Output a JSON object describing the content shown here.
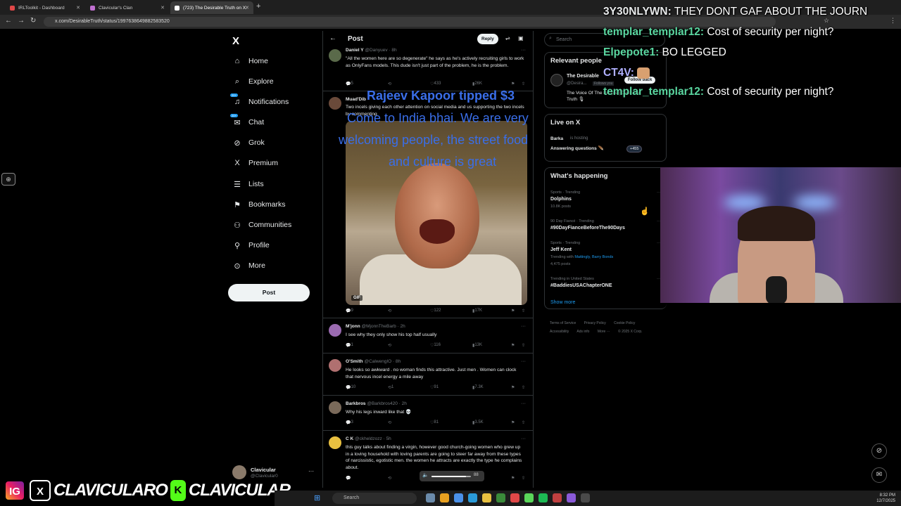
{
  "browser": {
    "tabs": [
      {
        "label": "IRLToolkit - Dashboard",
        "color": "#e04848"
      },
      {
        "label": "Clavicular's Clan",
        "color": "#c070d0"
      },
      {
        "label": "(723) The Desirable Truth on X:",
        "color": "#ffffff"
      }
    ],
    "new_tab": "+",
    "url": "x.com/DesirableTruth/status/1997638649882583520"
  },
  "sidebar": {
    "logo": "X",
    "items": [
      {
        "label": "Home",
        "icon": "home-icon",
        "glyph": "⌂"
      },
      {
        "label": "Explore",
        "icon": "search-icon",
        "glyph": "⌕"
      },
      {
        "label": "Notifications",
        "icon": "bell-icon",
        "glyph": "🔔",
        "badge": "20+"
      },
      {
        "label": "Chat",
        "icon": "chat-icon",
        "glyph": "✉",
        "badge": "20+"
      },
      {
        "label": "Grok",
        "icon": "grok-icon",
        "glyph": "⊘"
      },
      {
        "label": "Premium",
        "icon": "x-premium-icon",
        "glyph": "X"
      },
      {
        "label": "Lists",
        "icon": "list-icon",
        "glyph": "☰"
      },
      {
        "label": "Bookmarks",
        "icon": "bookmark-icon",
        "glyph": "⚑"
      },
      {
        "label": "Communities",
        "icon": "communities-icon",
        "glyph": "👥"
      },
      {
        "label": "Profile",
        "icon": "profile-icon",
        "glyph": "👤"
      },
      {
        "label": "More",
        "icon": "more-icon",
        "glyph": "⊙"
      }
    ],
    "post_button": "Post",
    "account": {
      "name": "Clavicular",
      "handle": "@Clavicular0",
      "more": "···"
    }
  },
  "main": {
    "header": {
      "back": "←",
      "title": "Post",
      "reply": "Reply"
    },
    "tweets": [
      {
        "name": "Daniel Y",
        "handle": "@Danyuev",
        "time": "8h",
        "text": "\"All the women here are so degenerate\" he says as he's actively recruiting girls to work as OnlyFans models. This dude isn't just part of the problem, he is the problem.",
        "replies": "5",
        "retweets": "",
        "likes": "433",
        "views": "26K",
        "avatar_color": "#5a6a4a"
      },
      {
        "name": "Muad'Dib",
        "handle": "@Muad",
        "time": "",
        "text": "Two incels giving each other attention on social media and us supporting the two incels by commenting",
        "replies": "9",
        "retweets": "",
        "likes": "122",
        "views": "17K",
        "avatar_color": "#6a4a3a",
        "media": "GIF"
      },
      {
        "name": "M'jonn",
        "handle": "@MjonnTheBarb",
        "time": "2h",
        "text": "I see why they only show his top half usually",
        "replies": "1",
        "retweets": "",
        "likes": "116",
        "views": "13K",
        "avatar_color": "#9a6ab0"
      },
      {
        "name": "O'Smith",
        "handle": "@CalwengIO",
        "time": "8h",
        "text": "He looks so awkward . no woman finds this attractive.  Just men .  Women can clock that nervous incel energy a mile away",
        "replies": "10",
        "retweets": "1",
        "likes": "91",
        "views": "7.3K",
        "avatar_color": "#b07070"
      },
      {
        "name": "Barkbros",
        "handle": "@Barkbros420",
        "time": "2h",
        "text": "Why his legs inward like that 💀",
        "replies": "3",
        "retweets": "",
        "likes": "81",
        "views": "3.5K",
        "avatar_color": "#7a6a5a"
      },
      {
        "name": "C K",
        "handle": "@ckheldzozz",
        "time": "5h",
        "text": "this guy talks about finding a virgin, however good church-going women who grew up in a loving household with loving parents are going to steer far away from these types of narcissistic, egotistic men. the women he attracts are exactly the type he complains about.",
        "replies": "",
        "retweets": "",
        "likes": "",
        "views": "",
        "avatar_color": "#e8c040"
      }
    ]
  },
  "right": {
    "search_placeholder": "Search",
    "relevant": {
      "title": "Relevant people",
      "name": "The Desirable",
      "handle": "@Desira...",
      "follows_you": "Follows you",
      "follow_back": "Follow back",
      "bio": "The Voice Of The People | Desirable Truth 🎙"
    },
    "live": {
      "title": "Live on X",
      "host": "Barka",
      "hosting": "is hosting",
      "topic": "Answering questions 🪶",
      "count": "+455"
    },
    "happening": {
      "title": "What's happening",
      "trends": [
        {
          "category": "Sports · Trending",
          "name": "Dolphins",
          "meta": "10.8K posts",
          "link": ""
        },
        {
          "category": "90 Day Fiancé · Trending",
          "name": "#90DayFianceBeforeThe90Days",
          "meta": "",
          "link": ""
        },
        {
          "category": "Sports · Trending",
          "name": "Jeff Kent",
          "meta": "Trending with",
          "link": "Mattingly, Barry Bonds",
          "meta2": "4,475 posts"
        },
        {
          "category": "Trending in United States",
          "name": "#BaddiesUSAChapterONE",
          "meta": "",
          "link": ""
        }
      ],
      "show_more": "Show more"
    },
    "footer": [
      "Terms of Service",
      "Privacy Policy",
      "Cookie Policy",
      "Accessibility",
      "Ads info",
      "More ···",
      "© 2025 X Corp."
    ]
  },
  "overlay": {
    "chat": [
      {
        "user": "3Y30NLYWN:",
        "msg": "THEY DONT GAF ABOUT THE JOURN",
        "color": "#e7e9ea"
      },
      {
        "user": "templar_templar12:",
        "msg": "Cost of security per night?",
        "color": "#5ad6a0"
      },
      {
        "user": "Elpepote1:",
        "msg": "BO LEGGED",
        "color": "#5ad6a0"
      },
      {
        "user": "CT4V:",
        "msg": "",
        "color": "#b0b0ff"
      },
      {
        "user": "templar_templar12:",
        "msg": "Cost of security per night?",
        "color": "#5ad6a0"
      }
    ],
    "tip_title": "Rajeev Kapoor tipped $3",
    "tip_lines": [
      "Come to India bhai. We are very",
      "welcoming people, the street food",
      "and culture is great"
    ],
    "volume_value": "88",
    "volume_fraction": 0.88,
    "socials": {
      "instagram": "IG",
      "x": "X",
      "kick": "K",
      "name1": "CLAVICULARO",
      "name2": "CLAVICULAR"
    }
  },
  "taskbar": {
    "search": "Search",
    "time": "8:32 PM",
    "date": "12/7/2025"
  }
}
